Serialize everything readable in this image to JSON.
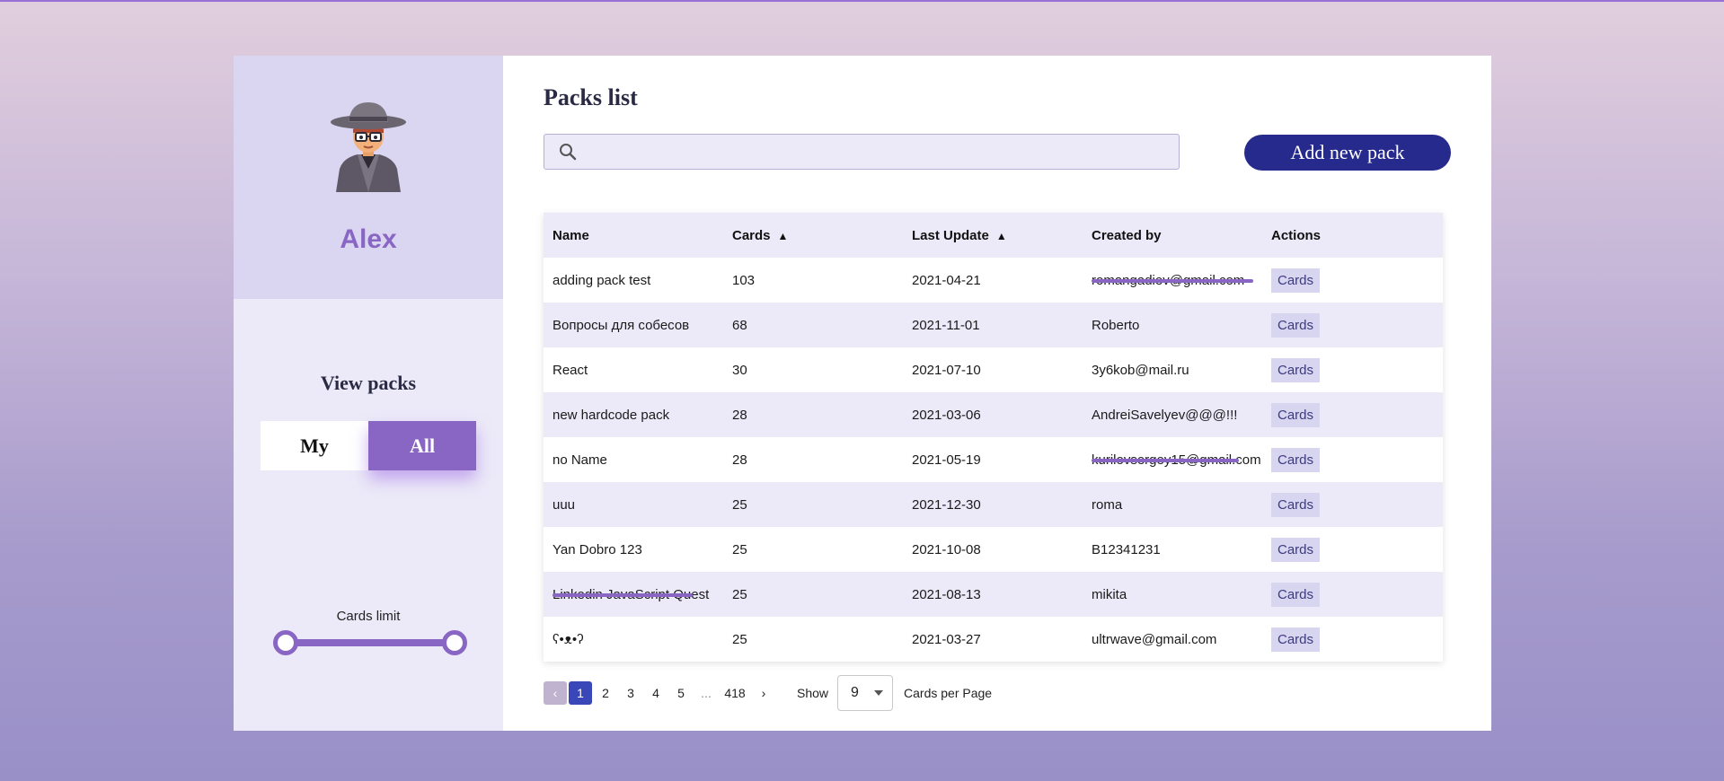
{
  "user": {
    "name": "Alex"
  },
  "sidebar": {
    "view_title": "View packs",
    "toggle": {
      "my": "My",
      "all": "All",
      "selected": "All"
    },
    "limit_label": "Cards limit",
    "limit_range": {
      "min_fraction": 0,
      "max_fraction": 1
    }
  },
  "main": {
    "title": "Packs list",
    "search": {
      "value": "",
      "placeholder": ""
    },
    "add_button": "Add new pack"
  },
  "table": {
    "headers": {
      "name": "Name",
      "cards": "Cards",
      "last_update": "Last Update",
      "created_by": "Created by",
      "actions": "Actions"
    },
    "sort_glyph": "▲",
    "rows": [
      {
        "name": "adding pack test",
        "cards": "103",
        "updated": "2021-04-21",
        "created_by": "romangadiev@gmail.com",
        "action": "Cards"
      },
      {
        "name": "Вопросы для собесов",
        "cards": "68",
        "updated": "2021-11-01",
        "created_by": "Roberto",
        "action": "Cards"
      },
      {
        "name": "React",
        "cards": "30",
        "updated": "2021-07-10",
        "created_by": "3y6kob@mail.ru",
        "action": "Cards"
      },
      {
        "name": "new hardcode pack",
        "cards": "28",
        "updated": "2021-03-06",
        "created_by": "AndreiSavelyev@@@!!!",
        "action": "Cards"
      },
      {
        "name": "no Name",
        "cards": "28",
        "updated": "2021-05-19",
        "created_by": "kurilovsergey15@gmail.com",
        "action": "Cards"
      },
      {
        "name": "uuu",
        "cards": "25",
        "updated": "2021-12-30",
        "created_by": "roma",
        "action": "Cards"
      },
      {
        "name": "Yan Dobro 123",
        "cards": "25",
        "updated": "2021-10-08",
        "created_by": "B12341231",
        "action": "Cards"
      },
      {
        "name": "Linkedin JavaScript Quest",
        "cards": "25",
        "updated": "2021-08-13",
        "created_by": "mikita",
        "action": "Cards"
      },
      {
        "name": "ʕ•ᴥ•ʔ",
        "cards": "25",
        "updated": "2021-03-27",
        "created_by": "ultrwave@gmail.com",
        "action": "Cards"
      }
    ]
  },
  "pagination": {
    "prev": "‹",
    "pages": [
      "1",
      "2",
      "3",
      "4",
      "5"
    ],
    "dots": "...",
    "last": "418",
    "next": "›",
    "current": "1",
    "show_label": "Show",
    "per_page_value": "9",
    "per_page_label": "Cards per Page"
  },
  "colors": {
    "accent": "#8a66c4",
    "button": "#262a8c",
    "active_page": "#3a47b8"
  },
  "icons": {
    "search": "search-icon",
    "dropdown": "chevron-down-icon",
    "avatar": "avatar-detective"
  }
}
